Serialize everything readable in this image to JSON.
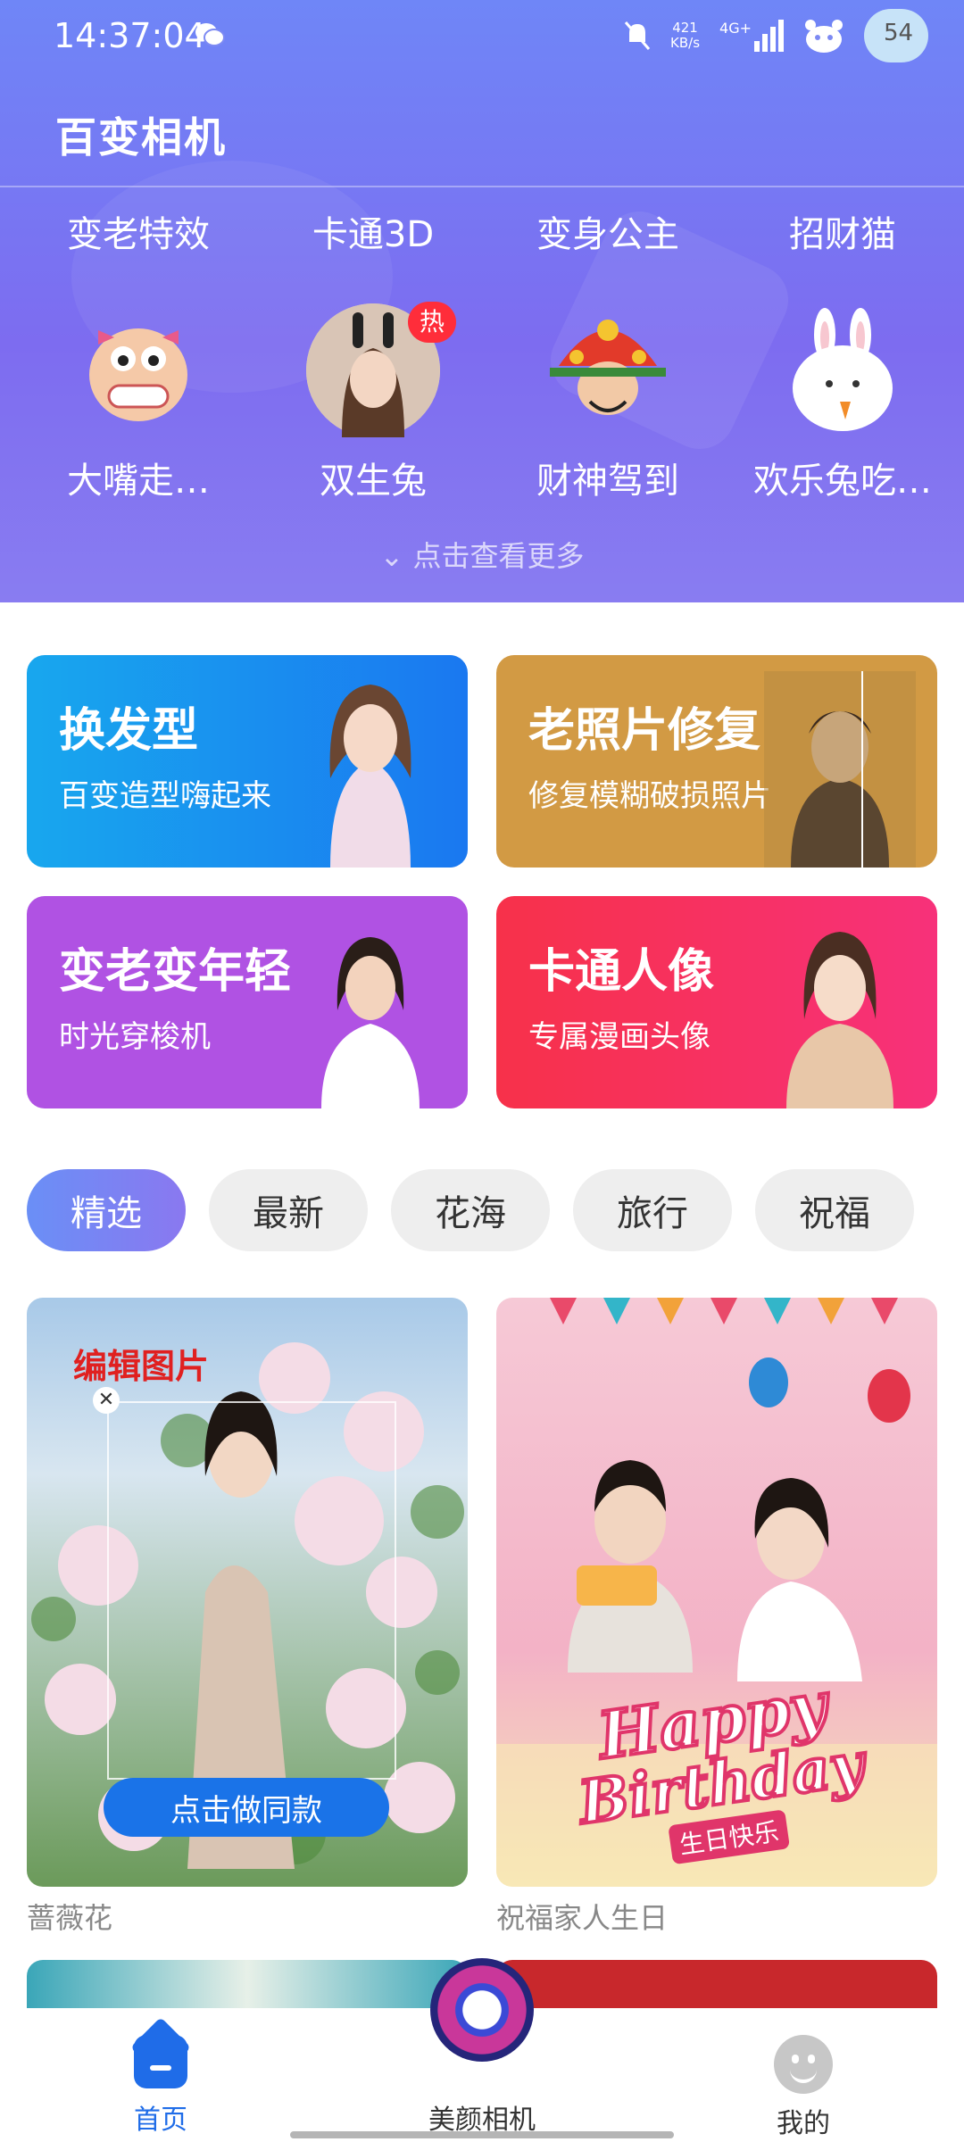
{
  "status": {
    "time": "14:37:04",
    "speed_value": "421",
    "speed_unit": "KB/s",
    "network": "4G+",
    "avatar_number": "54"
  },
  "header": {
    "title": "百变相机"
  },
  "effects_row1": [
    "变老特效",
    "卡通3D",
    "变身公主",
    "招财猫"
  ],
  "effects_row2": [
    {
      "label": "大嘴走…"
    },
    {
      "label": "双生兔",
      "badge": "热"
    },
    {
      "label": "财神驾到"
    },
    {
      "label": "欢乐兔吃…"
    }
  ],
  "more_label": "点击查看更多",
  "features": [
    {
      "title": "换发型",
      "subtitle": "百变造型嗨起来",
      "color": "#1e88f5"
    },
    {
      "title": "老照片修复",
      "subtitle": "修复模糊破损照片",
      "color": "#d29a44"
    },
    {
      "title": "变老变年轻",
      "subtitle": "时光穿梭机",
      "color": "#b052e3"
    },
    {
      "title": "卡通人像",
      "subtitle": "专属漫画头像",
      "color": "#f7315c"
    }
  ],
  "tabs": [
    "精选",
    "最新",
    "花海",
    "旅行",
    "祝福"
  ],
  "templates": [
    {
      "edit_label": "编辑图片",
      "button": "点击做同款",
      "caption": "蔷薇花"
    },
    {
      "caption": "祝福家人生日",
      "art_text_1": "Happy",
      "art_text_2": "Birthday",
      "art_text_3": "生日快乐"
    }
  ],
  "nav": {
    "home": "首页",
    "camera": "美颜相机",
    "mine": "我的"
  }
}
